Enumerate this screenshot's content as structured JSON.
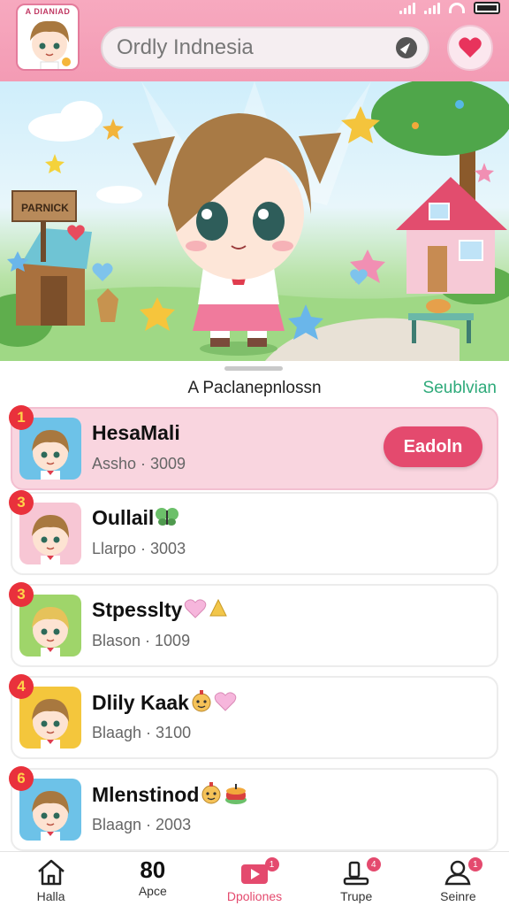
{
  "header": {
    "logo_text": "A DIANIAD",
    "search_value": "Ordly Indnesia"
  },
  "section": {
    "title": "A Paclanepnlossn",
    "link": "Seublvian"
  },
  "hero": {
    "sign_text": "PARNICK"
  },
  "list": [
    {
      "rank": "1",
      "name": "HesaMali",
      "meta": "Assho · 3009",
      "action": "Eadoln",
      "active": true
    },
    {
      "rank": "3",
      "name": "Oullail",
      "meta": "Llarpo · 3003",
      "emojis": [
        "butterfly"
      ]
    },
    {
      "rank": "3",
      "name": "Stpesslty",
      "meta": "Blason · 1009",
      "emojis": [
        "pink-heart",
        "yellow-cone"
      ]
    },
    {
      "rank": "4",
      "name": "Dlily Kaak",
      "meta": "Blaagh · 3100",
      "emojis": [
        "face",
        "pink-heart"
      ]
    },
    {
      "rank": "6",
      "name": "Mlenstinod",
      "meta": "Blaagn · 2003",
      "emojis": [
        "face",
        "cake"
      ]
    }
  ],
  "nav": [
    {
      "label": "Halla",
      "icon": "home-icon"
    },
    {
      "label": "Apce",
      "icon": "number",
      "number": "80"
    },
    {
      "label": "Dpoliones",
      "icon": "play-icon",
      "badge": "1",
      "active": true
    },
    {
      "label": "Trupe",
      "icon": "tray-icon",
      "badge": "4"
    },
    {
      "label": "Seinre",
      "icon": "person-icon",
      "badge": "1"
    }
  ],
  "colors": {
    "accent": "#e44a6e",
    "header_pink": "#f39bb4",
    "link_green": "#2eaa7a",
    "rank_red": "#e9313c"
  }
}
